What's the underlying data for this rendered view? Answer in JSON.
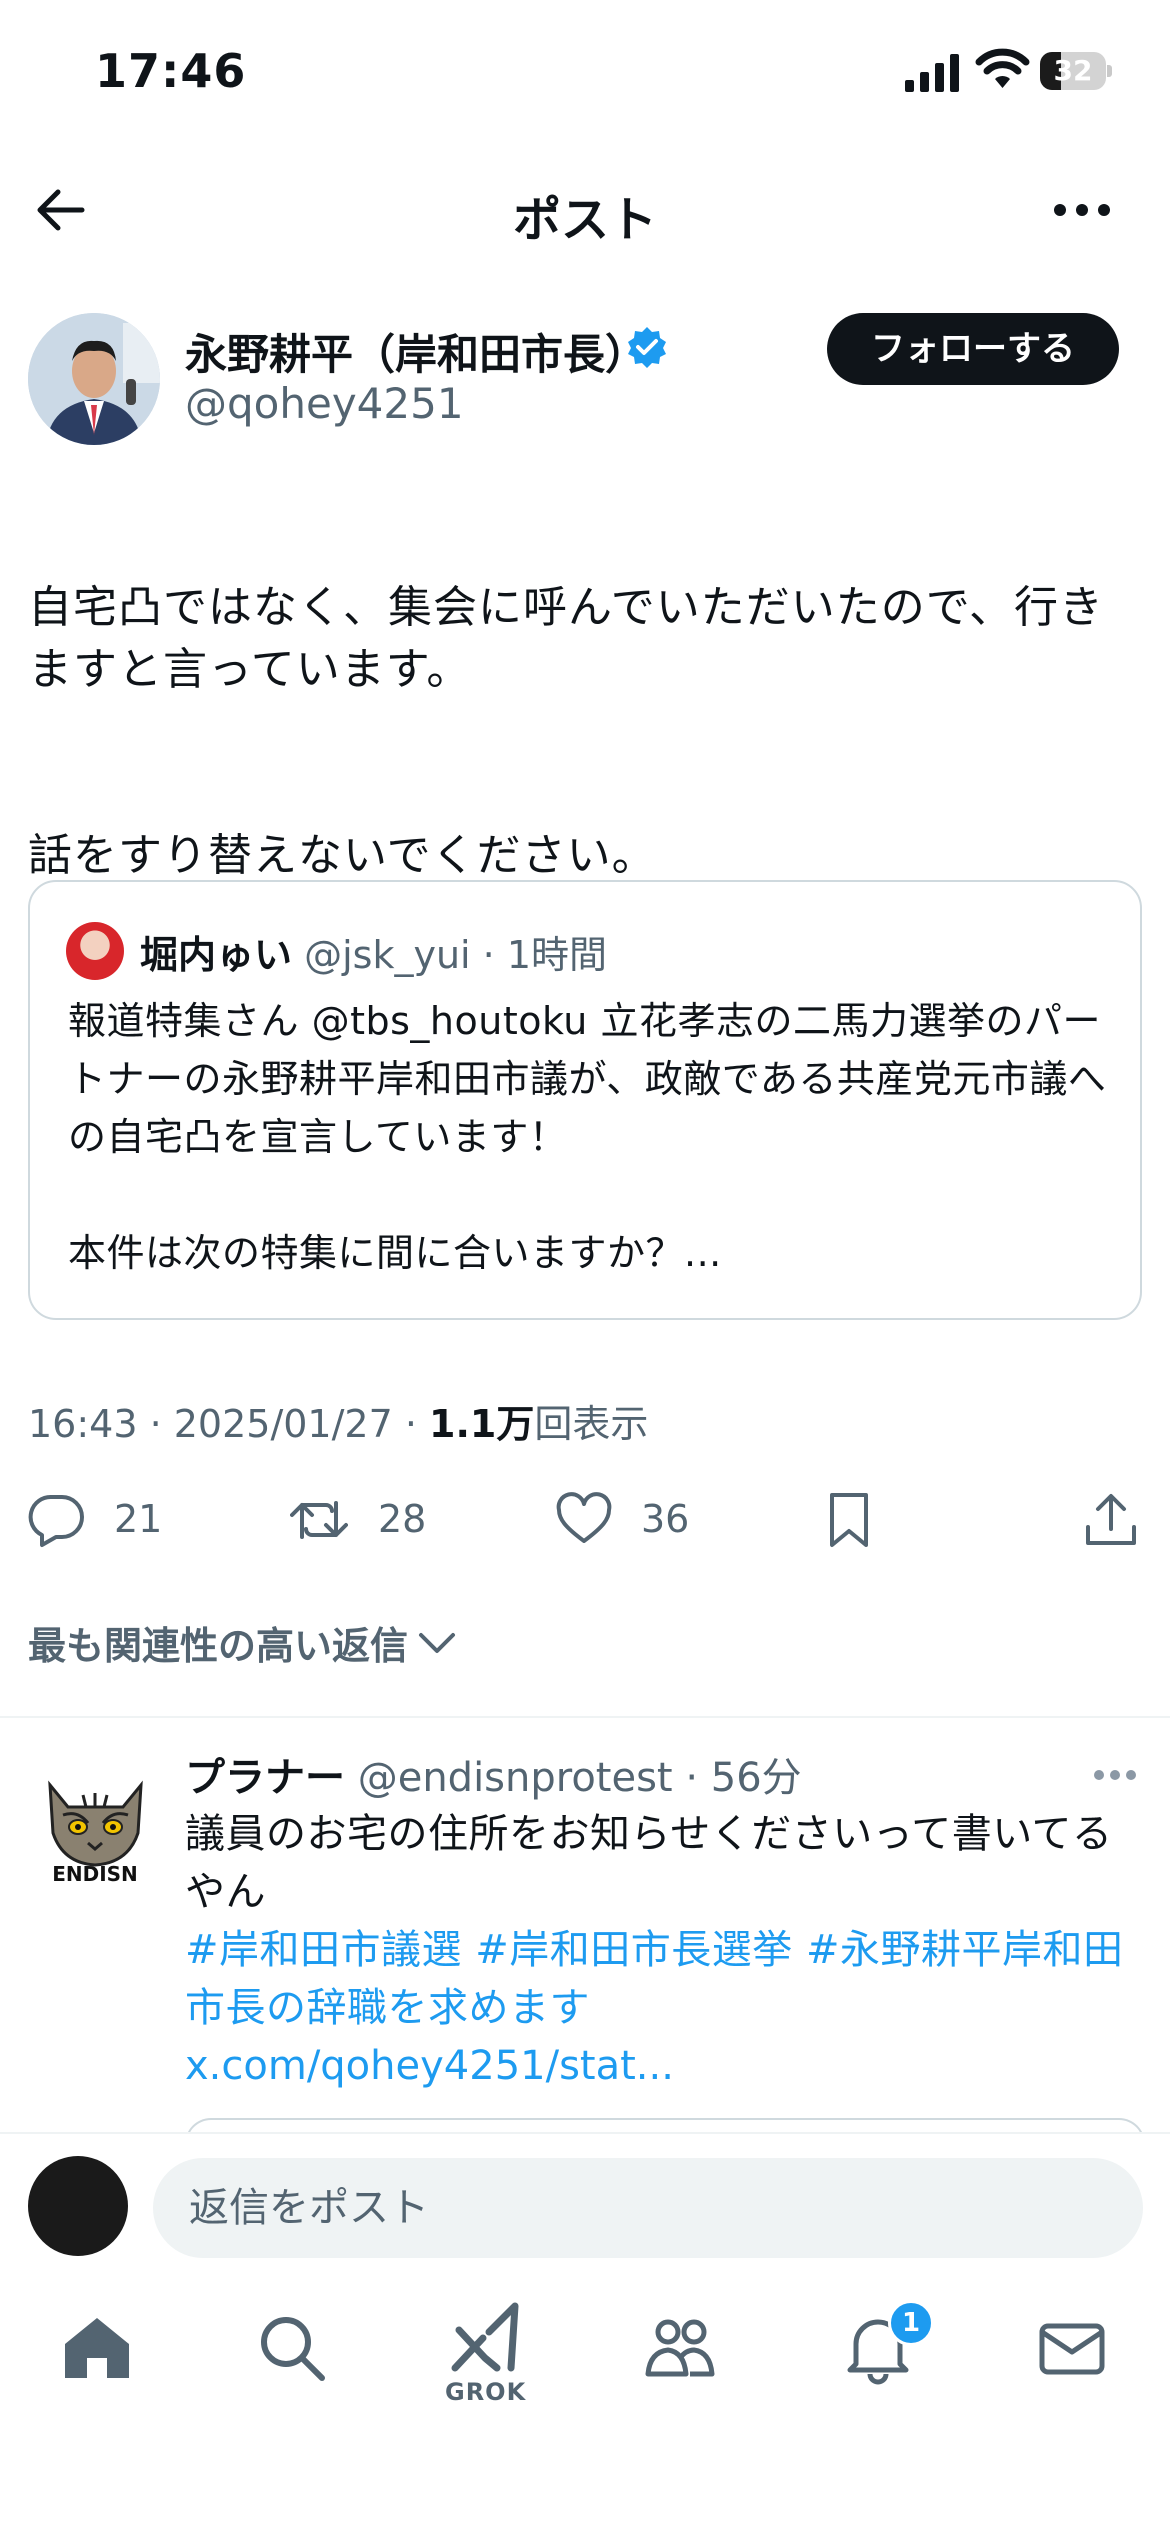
{
  "status_bar": {
    "time": "17:46",
    "battery": "32",
    "battery_level": 0.32
  },
  "header": {
    "title": "ポスト"
  },
  "post": {
    "author_name": "永野耕平（岸和田市長）",
    "author_handle": "@qohey4251",
    "follow_label": "フォローする",
    "body": [
      "自宅凸ではなく、集会に呼んでいただいたので、行きますと言っています。",
      "話をすり替えないでください。"
    ],
    "timestamp": "16:43 · 2025/01/27 · ",
    "views_count": "1.1万",
    "views_label": "回表示",
    "replies": "21",
    "reposts": "28",
    "likes": "36"
  },
  "quote": {
    "name": "堀内ゅい",
    "meta": " @jsk_yui · 1時間",
    "body": [
      "報道特集さん @tbs_houtoku 立花孝志の二馬力選挙のパートナーの永野耕平岸和田市議が、政敵である共産党元市議への自宅凸を宣言しています！",
      "本件は次の特集に間に合いますか？..."
    ]
  },
  "replies_section": {
    "sort_label": "最も関連性の高い返信"
  },
  "reply": {
    "name": "プラナー",
    "meta": " @endisnprotest · 56分",
    "text": "議員のお宅の住所をお知らせくださいって書いてるやん",
    "tags": "#岸和田市議選 #岸和田市長選挙 #永野耕平岸和田市長の辞職を求めます",
    "link": "x.com/qohey4251/stat...",
    "avatar_text": "ENDISN"
  },
  "composer": {
    "placeholder": "返信をポスト"
  },
  "tabbar": {
    "grok_label": "GROK",
    "notification_count": "1"
  },
  "colors": {
    "accent": "#1d9bf0",
    "text": "#0f1419",
    "secondary": "#536471"
  }
}
